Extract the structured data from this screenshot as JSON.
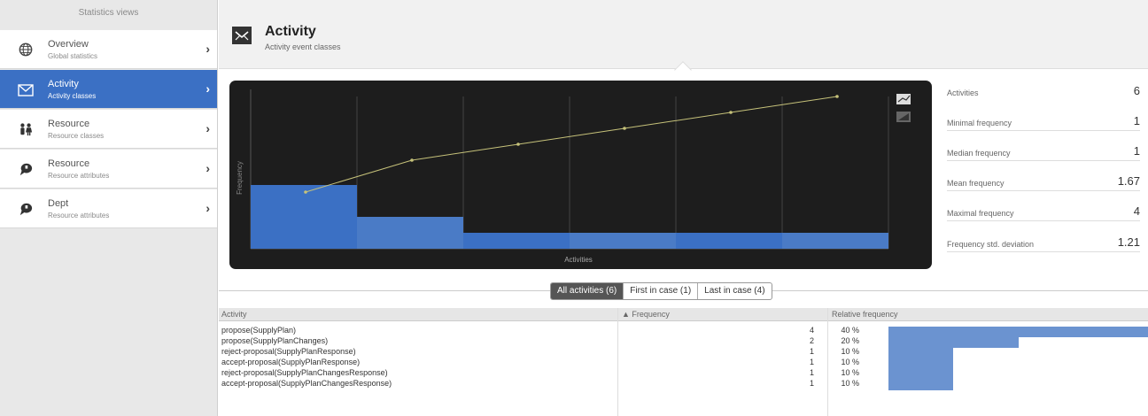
{
  "sidebar": {
    "title": "Statistics views",
    "items": [
      {
        "label": "Overview",
        "sub": "Global statistics",
        "icon": "globe-icon"
      },
      {
        "label": "Activity",
        "sub": "Activity classes",
        "icon": "envelope-icon",
        "active": true
      },
      {
        "label": "Resource",
        "sub": "Resource classes",
        "icon": "people-icon"
      },
      {
        "label": "Resource",
        "sub": "Resource attributes",
        "icon": "speech-bubble-icon"
      },
      {
        "label": "Dept",
        "sub": "Resource attributes",
        "icon": "speech-bubble-icon"
      }
    ]
  },
  "header": {
    "title": "Activity",
    "subtitle": "Activity event classes",
    "icon": "envelope-icon"
  },
  "chart_data": {
    "type": "bar",
    "categories": [
      "propose(SupplyPlan)",
      "propose(SupplyPlanChanges)",
      "reject-proposal(SupplyPlanResponse)",
      "accept-proposal(SupplyPlanResponse)",
      "reject-proposal(SupplyPlanChangesResponse)",
      "accept-proposal(SupplyPlanChangesResponse)"
    ],
    "values": [
      4,
      2,
      1,
      1,
      1,
      1
    ],
    "cumulative": [
      4,
      6,
      7,
      8,
      9,
      10
    ],
    "xlabel": "Activities",
    "ylabel": "Frequency",
    "colors": {
      "bar": "#3b70c4",
      "line": "#c6c27a",
      "background": "#1d1d1d"
    }
  },
  "stats": [
    {
      "label": "Activities",
      "value": "6"
    },
    {
      "label": "Minimal frequency",
      "value": "1"
    },
    {
      "label": "Median frequency",
      "value": "1"
    },
    {
      "label": "Mean frequency",
      "value": "1.67"
    },
    {
      "label": "Maximal frequency",
      "value": "4"
    },
    {
      "label": "Frequency std. deviation",
      "value": "1.21"
    }
  ],
  "tabs": [
    {
      "label": "All activities (6)",
      "active": true
    },
    {
      "label": "First in case (1)"
    },
    {
      "label": "Last in case (4)"
    }
  ],
  "table": {
    "columns": [
      "Activity",
      "▲ Frequency",
      "Relative frequency"
    ],
    "rows": [
      {
        "activity": "propose(SupplyPlan)",
        "frequency": "4",
        "relative": "40 %",
        "fraction": 0.4
      },
      {
        "activity": "propose(SupplyPlanChanges)",
        "frequency": "2",
        "relative": "20 %",
        "fraction": 0.2
      },
      {
        "activity": "reject-proposal(SupplyPlanResponse)",
        "frequency": "1",
        "relative": "10 %",
        "fraction": 0.1
      },
      {
        "activity": "accept-proposal(SupplyPlanResponse)",
        "frequency": "1",
        "relative": "10 %",
        "fraction": 0.1
      },
      {
        "activity": "reject-proposal(SupplyPlanChangesResponse)",
        "frequency": "1",
        "relative": "10 %",
        "fraction": 0.1
      },
      {
        "activity": "accept-proposal(SupplyPlanChangesResponse)",
        "frequency": "1",
        "relative": "10 %",
        "fraction": 0.1
      }
    ]
  }
}
